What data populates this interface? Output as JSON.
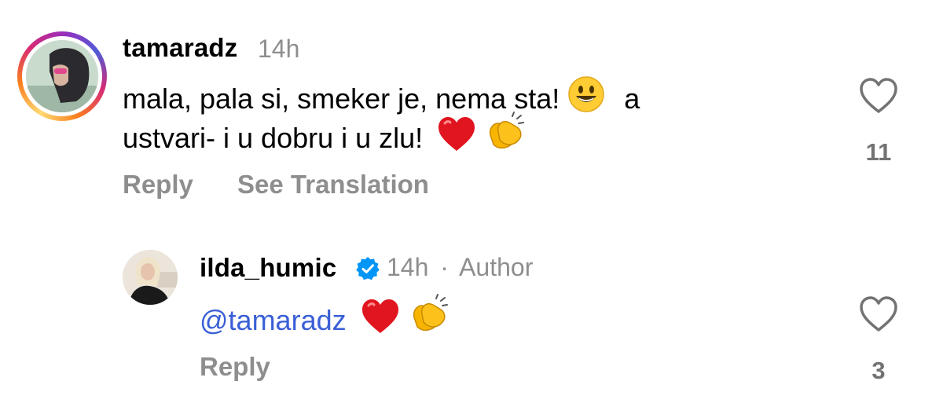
{
  "comment": {
    "username": "tamaradz",
    "time": "14h",
    "text_line1": "mala, pala si, smeker je, nema sta!",
    "text_line1_end": "a",
    "text_line2": "ustvari- i u dobru i u zlu!",
    "emojis": [
      "smiley-icon",
      "red-heart-icon",
      "clapping-hands-icon"
    ],
    "actions": {
      "reply": "Reply",
      "see_translation": "See Translation"
    },
    "like_count": "11"
  },
  "reply": {
    "username": "ilda_humic",
    "verified": true,
    "time": "14h",
    "separator": "·",
    "author_label": "Author",
    "mention": "@tamaradz",
    "emojis": [
      "red-heart-icon",
      "clapping-hands-icon"
    ],
    "actions": {
      "reply": "Reply"
    },
    "like_count": "3"
  },
  "colors": {
    "secondary_text": "#8e8e8e",
    "mention_blue": "#3a5fd6",
    "verified_blue": "#0095f6"
  }
}
